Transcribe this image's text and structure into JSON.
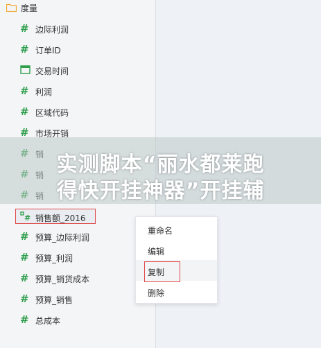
{
  "tree": {
    "folder_label": "度量",
    "fields": [
      {
        "label": "边际利润",
        "icon": "number-icon"
      },
      {
        "label": "订单ID",
        "icon": "number-icon"
      },
      {
        "label": "交易时间",
        "icon": "calendar-icon"
      },
      {
        "label": "利润",
        "icon": "number-icon"
      },
      {
        "label": "区域代码",
        "icon": "number-icon"
      },
      {
        "label": "市场开销",
        "icon": "number-icon"
      },
      {
        "label": "销",
        "icon": "number-icon"
      },
      {
        "label": "销",
        "icon": "number-icon"
      },
      {
        "label": "销",
        "icon": "number-icon"
      },
      {
        "label": "销售额_2016",
        "icon": "calculated-field-icon"
      },
      {
        "label": "预算_边际利润",
        "icon": "number-icon"
      },
      {
        "label": "预算_利润",
        "icon": "number-icon"
      },
      {
        "label": "预算_销货成本",
        "icon": "number-icon"
      },
      {
        "label": "预算_销售",
        "icon": "number-icon"
      },
      {
        "label": "总成本",
        "icon": "number-icon"
      }
    ]
  },
  "context_menu": {
    "items": [
      "重命名",
      "编辑",
      "复制",
      "删除"
    ]
  },
  "overlay": {
    "line1": "实测脚本“丽水都莱跑",
    "line2": "得快开挂神器”开挂辅"
  },
  "colors": {
    "number_icon": "#2e9e4b",
    "highlight_border": "#e04848",
    "folder": "#f0a830"
  }
}
